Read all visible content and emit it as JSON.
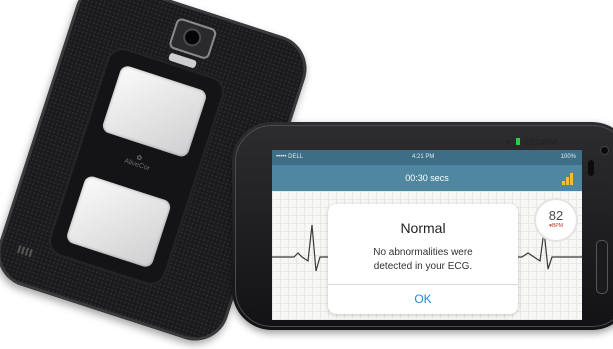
{
  "back_phone": {
    "brand_label": "AliveCor"
  },
  "status_bar": {
    "carrier": "••••• DELL",
    "time": "4:21 PM",
    "battery": "100%"
  },
  "app_bar": {
    "title": "00:30 secs"
  },
  "device_status": {
    "clock": "12:24PM"
  },
  "heart_rate": {
    "value": "82",
    "unit": "BPM"
  },
  "dialog": {
    "title": "Normal",
    "message_line1": "No abnormalities were",
    "message_line2": "detected in your ECG.",
    "ok_label": "OK"
  },
  "colors": {
    "status_bar": "#3d6e86",
    "app_bar": "#4f86a0",
    "ok_text": "#2b88d8",
    "signal_bars": "#f0c030"
  }
}
